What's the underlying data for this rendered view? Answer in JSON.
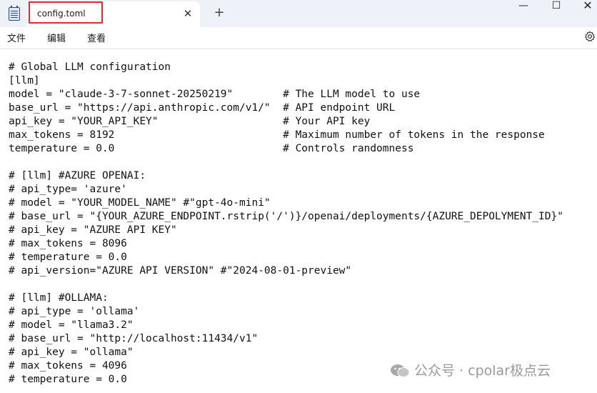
{
  "window": {
    "tab_title": "config.toml",
    "close_glyph": "✕",
    "new_tab_glyph": "+",
    "minimize_glyph": "—",
    "maximize_glyph": "☐",
    "close_window_glyph": "✕"
  },
  "menu": {
    "file": "文件",
    "edit": "编辑",
    "view": "查看",
    "settings_icon": "gear-icon"
  },
  "colors": {
    "highlight_box": "#e8262b",
    "titlebar_bg": "#eef2f8"
  },
  "editor": {
    "lines": [
      "# Global LLM configuration",
      "[llm]",
      "model = \"claude-3-7-sonnet-20250219\"        # The LLM model to use",
      "base_url = \"https://api.anthropic.com/v1/\"  # API endpoint URL",
      "api_key = \"YOUR_API_KEY\"                    # Your API key",
      "max_tokens = 8192                           # Maximum number of tokens in the response",
      "temperature = 0.0                           # Controls randomness",
      "",
      "# [llm] #AZURE OPENAI:",
      "# api_type= 'azure'",
      "# model = \"YOUR_MODEL_NAME\" #\"gpt-4o-mini\"",
      "# base_url = \"{YOUR_AZURE_ENDPOINT.rstrip('/')}/openai/deployments/{AZURE_DEPOLYMENT_ID}\"",
      "# api_key = \"AZURE API KEY\"",
      "# max_tokens = 8096",
      "# temperature = 0.0",
      "# api_version=\"AZURE API VERSION\" #\"2024-08-01-preview\"",
      "",
      "# [llm] #OLLAMA:",
      "# api_type = 'ollama'",
      "# model = \"llama3.2\"",
      "# base_url = \"http://localhost:11434/v1\"",
      "# api_key = \"ollama\"",
      "# max_tokens = 4096",
      "# temperature = 0.0"
    ]
  },
  "watermark": {
    "text": "公众号 · cpolar极点云"
  }
}
